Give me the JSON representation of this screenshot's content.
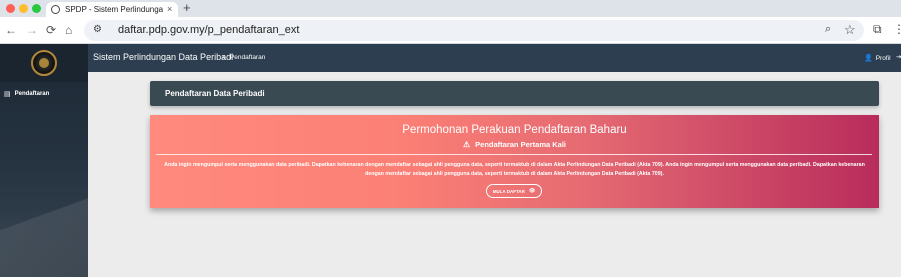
{
  "browser": {
    "tab_title": "SPDP - Sistem Perlindungan Data Peribadi",
    "tab_close": "×",
    "new_tab": "+",
    "url": "daftar.pdp.gov.my/p_pendaftaran_ext",
    "icons": {
      "back": "←",
      "forward": "→",
      "reload": "⟳",
      "home": "⌂",
      "site_info": "⚙",
      "zoom": "⌕",
      "star": "☆",
      "extensions": "⧉",
      "menu": "⋮"
    }
  },
  "sidebar": {
    "items": [
      {
        "icon": "▤",
        "label": "Pendaftaran"
      }
    ]
  },
  "topnav": {
    "brand": "Sistem Perlindungan Data Peribadi",
    "breadcrumb_icon": "»",
    "breadcrumb": "Pendaftaran",
    "profile_icon": "👤",
    "profile": "Profil",
    "profile_extra": "⇥"
  },
  "card_header": {
    "title": "Pendaftaran Data Peribadi"
  },
  "hero": {
    "title": "Permohonan Perakuan Pendaftaran Baharu",
    "subtitle_icon": "⚠",
    "subtitle": "Pendaftaran Pertama Kali",
    "description": "Anda ingin mengumpul serta menggunakan data peribadi. Dapatkan kebenaran dengan mendaftar sebagai ahli pengguna data, seperti termaktub di dalam Akta Perlindungan Data Peribadi (Akta 709). Anda ingin mengumpul serta menggunakan data peribadi. Dapatkan kebenaran dengan mendaftar sebagai ahli pengguna data, seperti termaktub di dalam Akta Perlindungan Data Peribadi (Akta 709).",
    "button_label": "MULA DAFTAR",
    "button_icon": "👁"
  },
  "colors": {
    "sidebar_bg": "#1e2a36",
    "topnav_bg": "#2c3e50",
    "card_head_bg": "#3a4a53",
    "hero_start": "#ff8a7d",
    "hero_end": "#b82c5c"
  }
}
